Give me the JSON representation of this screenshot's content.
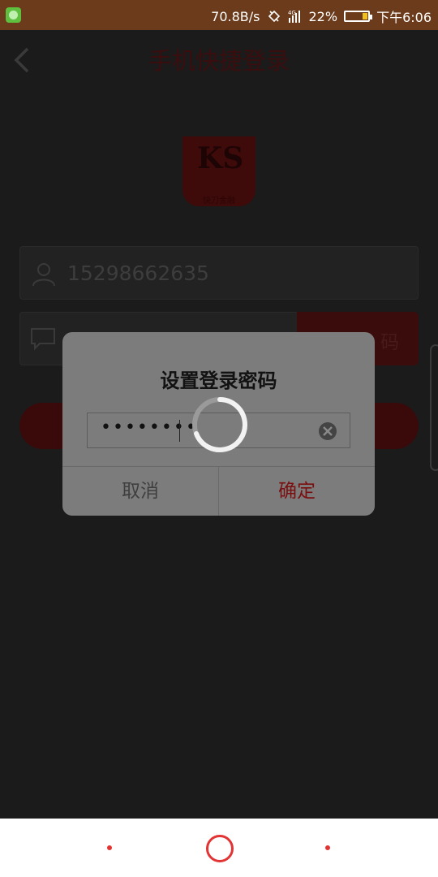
{
  "statusbar": {
    "speed": "70.8B/s",
    "signal": "4G",
    "battery": "22%",
    "time": "下午6:06"
  },
  "header": {
    "title": "手机快捷登录"
  },
  "logo": {
    "sub": "快刀金融"
  },
  "form": {
    "phone": "15298662635",
    "code_button_visible": "码"
  },
  "dialog": {
    "title": "设置登录密码",
    "password_mask": "••••••••",
    "cancel": "取消",
    "confirm": "确定"
  },
  "colors": {
    "accent": "#7a0f10",
    "statusbar": "#6b3b1b",
    "nav_accent": "#e23434"
  }
}
